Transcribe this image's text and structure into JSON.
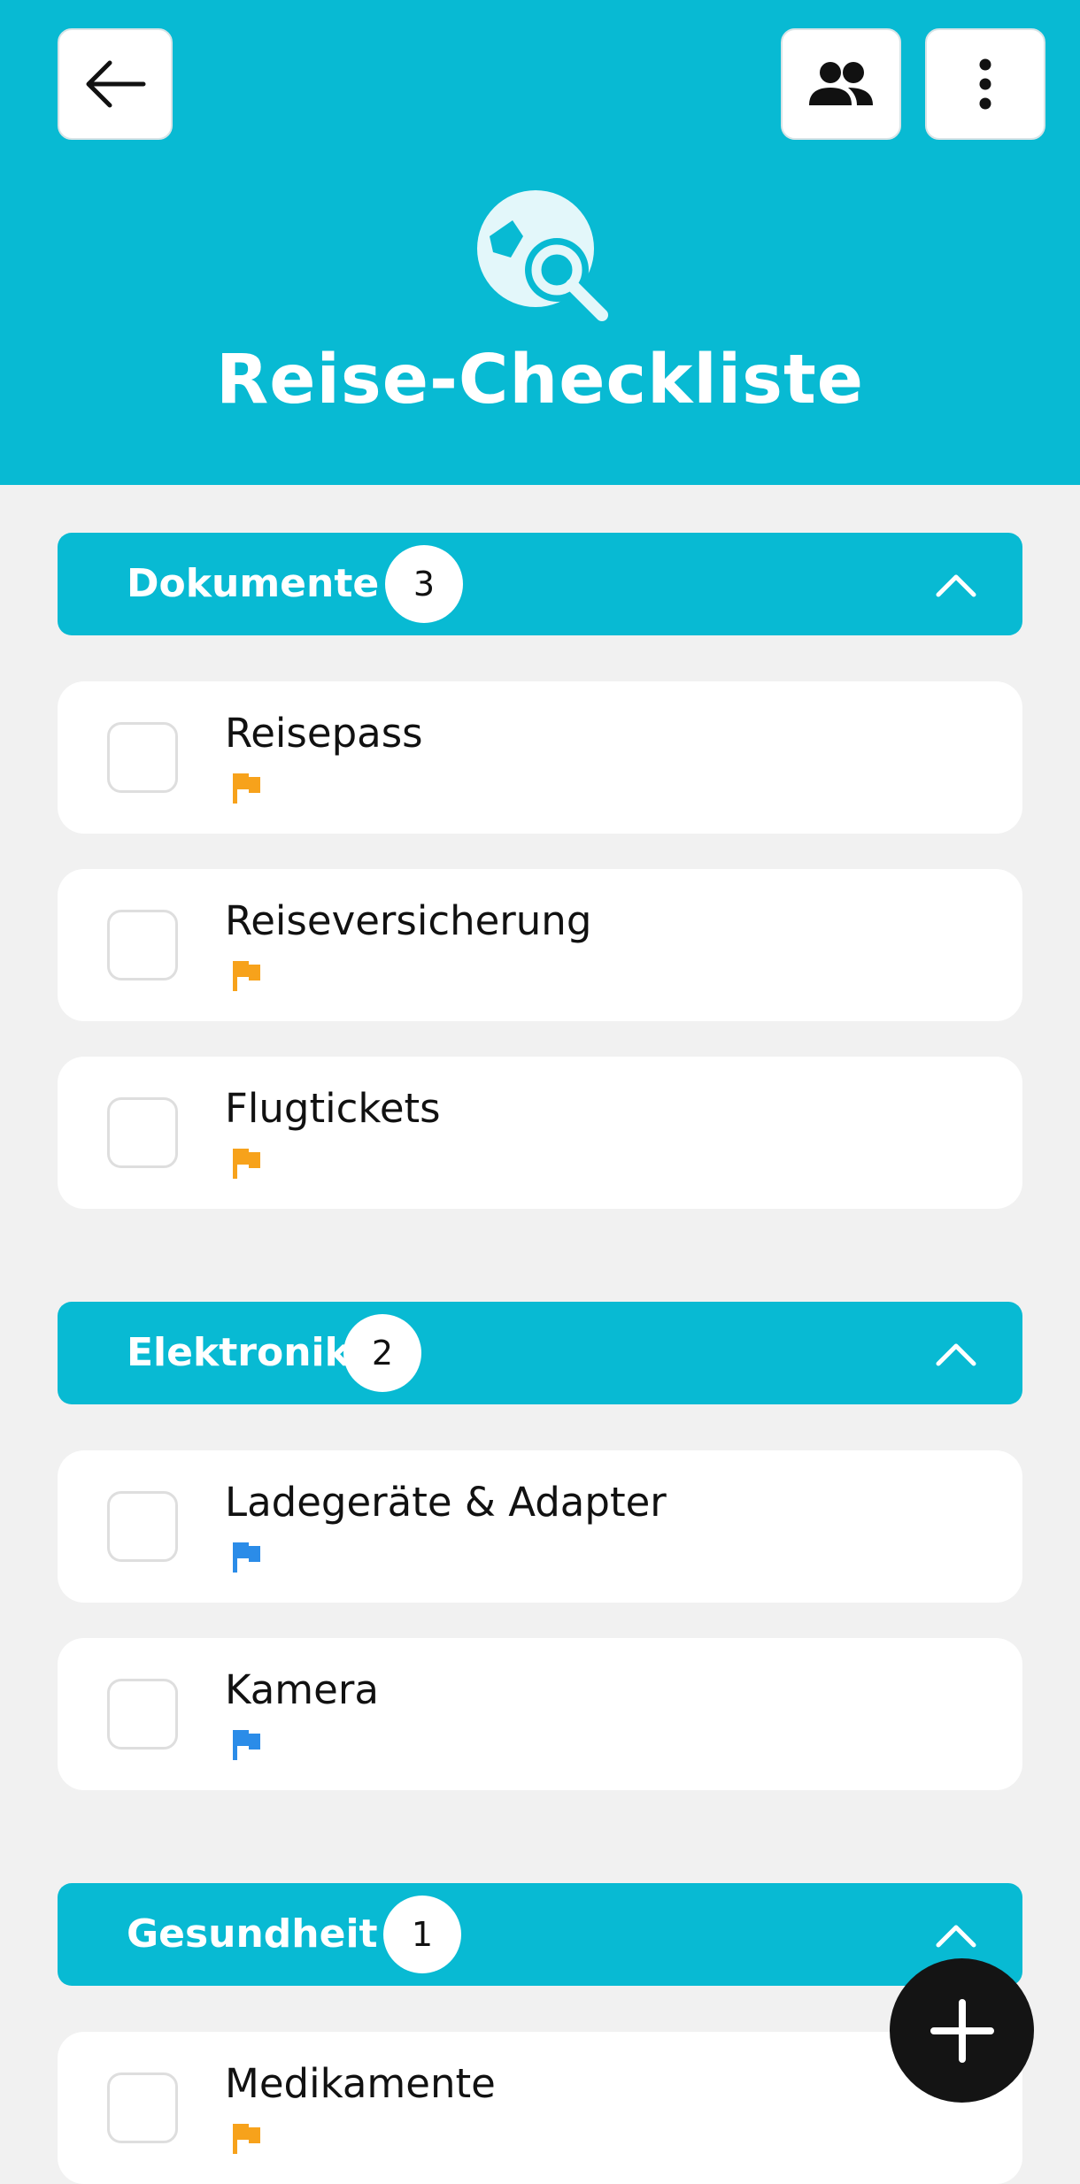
{
  "header": {
    "title": "Reise-Checkliste",
    "background_color": "#08bad3",
    "back_icon": "arrow-left-icon",
    "people_icon": "people-icon",
    "more_icon": "more-vertical-icon",
    "logo_icon": "globe-search-icon"
  },
  "categories": [
    {
      "label": "Dokumente",
      "count": "3",
      "items": [
        {
          "label": "Reisepass",
          "flag_color": "#f7a21b"
        },
        {
          "label": "Reiseversicherung",
          "flag_color": "#f7a21b"
        },
        {
          "label": "Flugtickets",
          "flag_color": "#f7a21b"
        }
      ]
    },
    {
      "label": "Elektronik",
      "count": "2",
      "items": [
        {
          "label": "Ladegeräte & Adapter",
          "flag_color": "#2b8ce8"
        },
        {
          "label": "Kamera",
          "flag_color": "#2b8ce8"
        }
      ]
    },
    {
      "label": "Gesundheit",
      "count": "1",
      "items": [
        {
          "label": "Medikamente",
          "flag_color": "#f7a21b"
        }
      ]
    }
  ],
  "fab": {
    "icon": "plus-icon"
  }
}
